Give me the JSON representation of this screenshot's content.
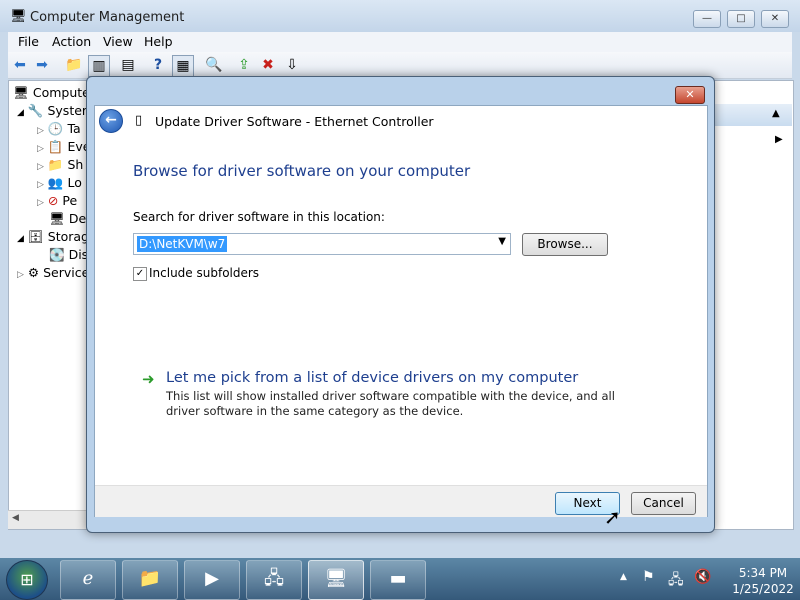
{
  "main_window": {
    "title": "Computer Management",
    "controls": {
      "minimize": "—",
      "maximize": "□",
      "close": "✕"
    },
    "menu": [
      "File",
      "Action",
      "View",
      "Help"
    ],
    "toolbar_icons": [
      "back-icon",
      "forward-icon",
      "up-folder-icon",
      "show-hide-tree-icon",
      "properties-icon",
      "help-icon",
      "view-icon",
      "scan-hardware-icon",
      "update-driver-icon",
      "uninstall-icon",
      "disable-icon"
    ],
    "tree": [
      {
        "label": "Computer",
        "icon": "🖥"
      },
      {
        "label": "System",
        "icon": "🔧"
      },
      {
        "label": "Ta",
        "icon": "🕒"
      },
      {
        "label": "Eve",
        "icon": "📋"
      },
      {
        "label": "Sh",
        "icon": "📁"
      },
      {
        "label": "Lo",
        "icon": "👥"
      },
      {
        "label": "Pe",
        "icon": "⊘"
      },
      {
        "label": "De",
        "icon": "🖥"
      },
      {
        "label": "Storag",
        "icon": "🗄"
      },
      {
        "label": "Dis",
        "icon": "💽"
      },
      {
        "label": "Service",
        "icon": "⚙"
      }
    ]
  },
  "dialog": {
    "title": "Update Driver Software - Ethernet Controller",
    "close": "✕",
    "heading": "Browse for driver software on your computer",
    "search_label": "Search for driver software in this location:",
    "path_value": "D:\\NetKVM\\w7",
    "browse_label": "Browse...",
    "include_subfolders_label": "Include subfolders",
    "include_subfolders_checked": true,
    "pick_link": "Let me pick from a list of device drivers on my computer",
    "pick_description": "This list will show installed driver software compatible with the device, and all driver software in the same category as the device.",
    "next_label": "Next",
    "cancel_label": "Cancel"
  },
  "taskbar": {
    "apps": [
      "explorer-icon",
      "internet-explorer-icon",
      "media-player-icon",
      "network-icon",
      "device-manager-icon",
      "cmd-icon"
    ],
    "time": "5:34 PM",
    "date": "1/25/2022"
  },
  "colors": {
    "link": "#1e3f8f",
    "accent": "#3399ff",
    "arrow_green": "#2b9b2b"
  }
}
